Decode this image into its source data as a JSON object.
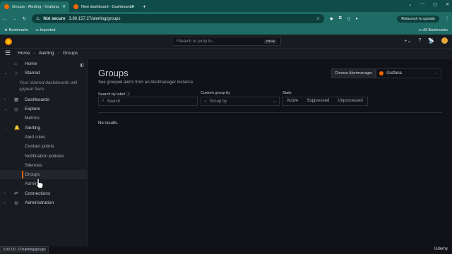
{
  "browser": {
    "tabs": [
      {
        "title": "Groups - Alerting - Grafana",
        "active": true
      },
      {
        "title": "New dashboard - Dashboards",
        "active": false
      }
    ],
    "new_tab": "+",
    "window_controls": [
      "⌄",
      "—",
      "▢",
      "✕"
    ],
    "not_secure": "Not secure",
    "url": "3.80.157.27/alerting/groups",
    "relaunch": "Relaunch to update",
    "bookmarks": [
      "Bookmarks",
      "Imported"
    ],
    "all_bookmarks": "All Bookmarks"
  },
  "grafana": {
    "search_placeholder": "Search or jump to...",
    "search_kbd": "ctrl+k",
    "top_icons": [
      "+⌄",
      "?",
      "📡"
    ],
    "breadcrumb": [
      "Home",
      "Alerting",
      "Groups"
    ]
  },
  "sidebar": {
    "items": [
      {
        "label": "Home",
        "icon": "⌂",
        "chev": ""
      },
      {
        "label": "Starred",
        "icon": "☆",
        "chev": "⌄"
      },
      {
        "label": "Dashboards",
        "icon": "▦",
        "chev": "›"
      },
      {
        "label": "Explore",
        "icon": "◎",
        "chev": "⌄"
      },
      {
        "label": "Metrics",
        "sub": true
      },
      {
        "label": "Alerting",
        "icon": "🔔",
        "chev": "⌄"
      },
      {
        "label": "Alert rules",
        "sub": true
      },
      {
        "label": "Contact points",
        "sub": true
      },
      {
        "label": "Notification policies",
        "sub": true
      },
      {
        "label": "Silences",
        "sub": true
      },
      {
        "label": "Groups",
        "sub": true,
        "active": true
      },
      {
        "label": "Admin",
        "sub": true
      },
      {
        "label": "Connections",
        "icon": "⇄",
        "chev": "›"
      },
      {
        "label": "Administration",
        "icon": "⚙",
        "chev": "›"
      }
    ],
    "starred_note": "Your starred dashboards will appear here"
  },
  "main": {
    "title": "Groups",
    "subtitle": "See grouped alerts from an Alertmanager instance",
    "am_label": "Choose Alertmanager",
    "am_value": "Grafana",
    "search_label": "Search by label",
    "search_placeholder": "Search",
    "group_label": "Custom group by",
    "group_placeholder": "Group by",
    "state_label": "State",
    "states": [
      "Active",
      "Suppressed",
      "Unprocessed"
    ],
    "no_results": "No results."
  },
  "status_url": "3.80.157.27/alerting/groups",
  "watermark": "Udemy",
  "colors": {
    "accent": "#f46800",
    "chrome": "#1f6b66"
  }
}
